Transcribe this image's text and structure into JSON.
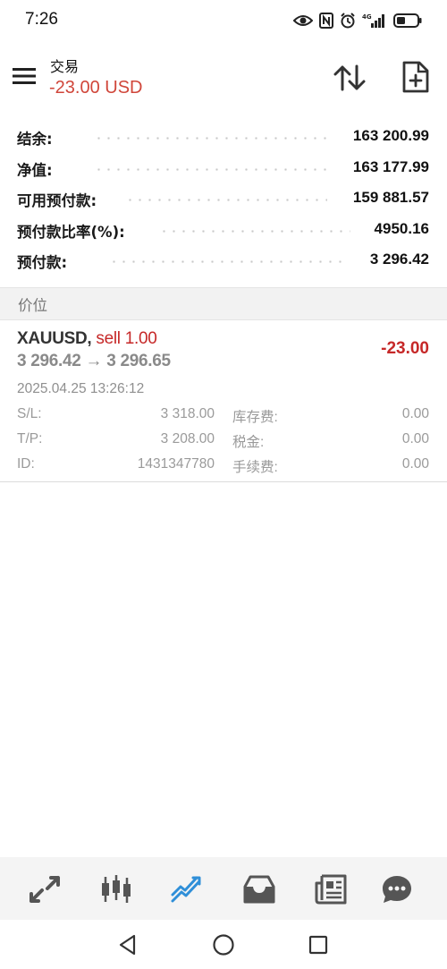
{
  "status_bar": {
    "time": "7:26",
    "network": "4G"
  },
  "header": {
    "title": "交易",
    "balance": "-23.00 USD"
  },
  "summary": [
    {
      "label": "结余:",
      "value": "163 200.99"
    },
    {
      "label": "净值:",
      "value": "163 177.99"
    },
    {
      "label": "可用预付款:",
      "value": "159 881.57"
    },
    {
      "label": "预付款比率(%):",
      "value": "4950.16"
    },
    {
      "label": "预付款:",
      "value": "3 296.42"
    }
  ],
  "section_title": "价位",
  "position": {
    "symbol": "XAUUSD,",
    "side": "sell 1.00",
    "prices": "3 296.42 → 3 296.65",
    "profit": "-23.00",
    "time": "2025.04.25 13:26:12",
    "sl_label": "S/L:",
    "sl_value": "3 318.00",
    "tp_label": "T/P:",
    "tp_value": "3 208.00",
    "id_label": "ID:",
    "id_value": "1431347780",
    "swap_label": "库存费:",
    "swap_value": "0.00",
    "tax_label": "税金:",
    "tax_value": "0.00",
    "commission_label": "手续费:",
    "commission_value": "0.00"
  },
  "bottom_nav": [
    {
      "name": "quotes-icon"
    },
    {
      "name": "chart-icon"
    },
    {
      "name": "trade-icon",
      "active": true
    },
    {
      "name": "history-icon"
    },
    {
      "name": "news-icon"
    },
    {
      "name": "chat-icon"
    }
  ],
  "colors": {
    "negative": "#c62828",
    "balance": "#d0463a",
    "accent": "#2f8fd8",
    "icon": "#555555"
  }
}
